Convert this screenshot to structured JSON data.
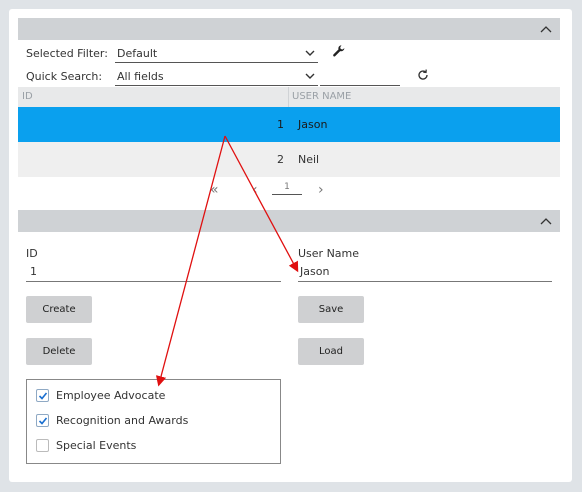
{
  "filter": {
    "selected_filter_label": "Selected Filter:",
    "selected_filter_value": "Default",
    "quick_search_label": "Quick Search:",
    "quick_search_value": "All fields",
    "search_text": ""
  },
  "icons": {
    "wrench": "wrench-icon",
    "refresh": "refresh-icon",
    "chevron_up": "chevron-up-icon",
    "chevron_down": "chevron-down-icon",
    "first_page": "double-chevron-left-icon",
    "prev_page": "chevron-left-icon",
    "next_page": "chevron-right-icon",
    "checkmark": "checkmark-icon"
  },
  "grid": {
    "columns": [
      "ID",
      "USER NAME"
    ],
    "rows": [
      {
        "id": "1",
        "name": "Jason",
        "selected": true
      },
      {
        "id": "2",
        "name": "Neil",
        "selected": false
      }
    ],
    "selected_color": "#0aa0ee"
  },
  "pager": {
    "first": "«",
    "prev": "‹",
    "page": "1",
    "next": "›"
  },
  "detail": {
    "id_label": "ID",
    "id_value": "1",
    "username_label": "User Name",
    "username_value": "Jason",
    "buttons": {
      "create": "Create",
      "save": "Save",
      "delete": "Delete",
      "load": "Load"
    }
  },
  "checklist": [
    {
      "label": "Employee Advocate",
      "checked": true
    },
    {
      "label": "Recognition and Awards",
      "checked": true
    },
    {
      "label": "Special Events",
      "checked": false
    }
  ],
  "annotation_color": "#e01010"
}
